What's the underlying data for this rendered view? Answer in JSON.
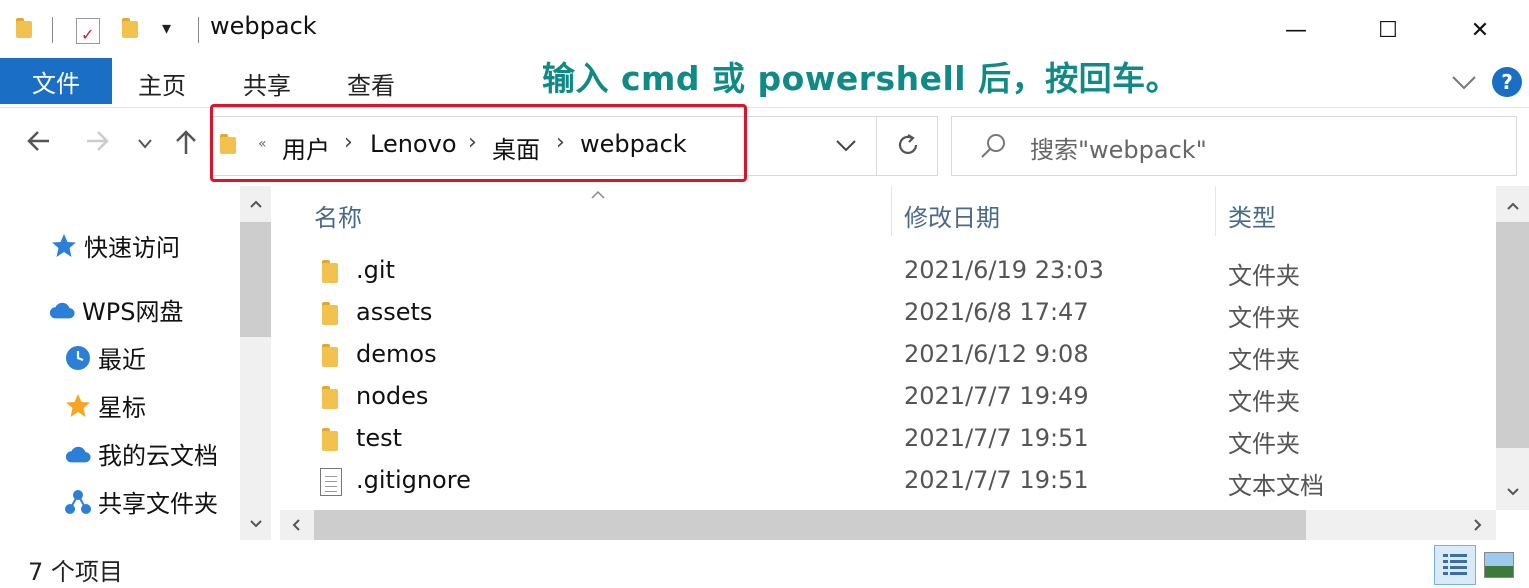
{
  "window": {
    "title": "webpack"
  },
  "window_controls": {
    "minimize": "—",
    "maximize": "☐",
    "close": "✕"
  },
  "quick_access_toolbar": {
    "dropdown_glyph": "▾"
  },
  "ribbon": {
    "tabs": [
      {
        "label": "文件"
      },
      {
        "label": "主页"
      },
      {
        "label": "共享"
      },
      {
        "label": "查看"
      }
    ],
    "help_label": "?"
  },
  "annotation": "输入 cmd 或 powershell 后，按回车。",
  "address_bar": {
    "overflow_glyph": "«",
    "crumbs": [
      "用户",
      "Lenovo",
      "桌面",
      "webpack"
    ],
    "separator": "›"
  },
  "search": {
    "placeholder": "搜索\"webpack\""
  },
  "nav_pane": {
    "items": [
      {
        "label": "快速访问",
        "icon": "star-pin-icon"
      },
      {
        "label": "WPS网盘",
        "icon": "cloud-icon"
      },
      {
        "label": "最近",
        "icon": "clock-icon"
      },
      {
        "label": "星标",
        "icon": "star-icon"
      },
      {
        "label": "我的云文档",
        "icon": "cloud-icon"
      },
      {
        "label": "共享文件夹",
        "icon": "share-icon"
      }
    ]
  },
  "columns": {
    "name": "名称",
    "date": "修改日期",
    "type": "类型"
  },
  "files": [
    {
      "name": ".git",
      "date": "2021/6/19 23:03",
      "type": "文件夹",
      "kind": "folder"
    },
    {
      "name": "assets",
      "date": "2021/6/8 17:47",
      "type": "文件夹",
      "kind": "folder"
    },
    {
      "name": "demos",
      "date": "2021/6/12 9:08",
      "type": "文件夹",
      "kind": "folder"
    },
    {
      "name": "nodes",
      "date": "2021/7/7 19:49",
      "type": "文件夹",
      "kind": "folder"
    },
    {
      "name": "test",
      "date": "2021/7/7 19:51",
      "type": "文件夹",
      "kind": "folder"
    },
    {
      "name": ".gitignore",
      "date": "2021/7/7 19:51",
      "type": "文本文档",
      "kind": "text"
    }
  ],
  "status": {
    "item_count": "7 个项目"
  },
  "colors": {
    "accent": "#1a6fc4",
    "annotation": "#0f8a87",
    "highlight": "#e0122a"
  }
}
